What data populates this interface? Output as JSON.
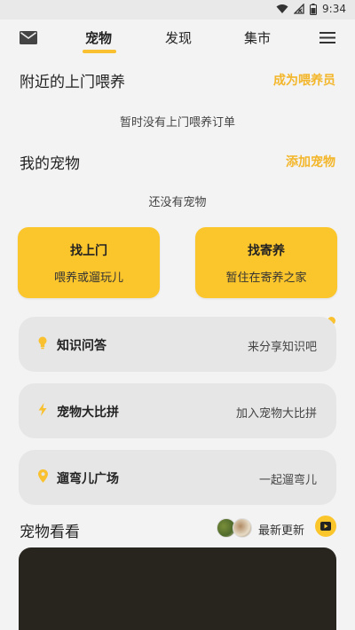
{
  "status_bar": {
    "time": "9:34"
  },
  "header": {
    "tabs": [
      {
        "label": "宠物",
        "active": true
      },
      {
        "label": "发现",
        "active": false
      },
      {
        "label": "集市",
        "active": false
      }
    ]
  },
  "nearby": {
    "title": "附近的上门喂养",
    "link": "成为喂养员",
    "empty": "暂时没有上门喂养订单"
  },
  "my_pets": {
    "title": "我的宠物",
    "link": "添加宠物",
    "empty": "还没有宠物"
  },
  "cards": [
    {
      "title": "找上门",
      "subtitle": "喂养或遛玩儿"
    },
    {
      "title": "找寄养",
      "subtitle": "暂住在寄养之家"
    }
  ],
  "rows": [
    {
      "icon": "lightbulb-icon",
      "title": "知识问答",
      "subtitle": "来分享知识吧"
    },
    {
      "icon": "lightning-icon",
      "title": "宠物大比拼",
      "subtitle": "加入宠物大比拼"
    },
    {
      "icon": "location-pin-icon",
      "title": "遛弯儿广场",
      "subtitle": "一起遛弯儿"
    }
  ],
  "pet_view": {
    "title": "宠物看看",
    "latest_label": "最新更新"
  },
  "colors": {
    "accent": "#fbc52c",
    "link": "#f3b62a",
    "background": "#f3f3f3",
    "row_card": "#e6e6e6"
  }
}
